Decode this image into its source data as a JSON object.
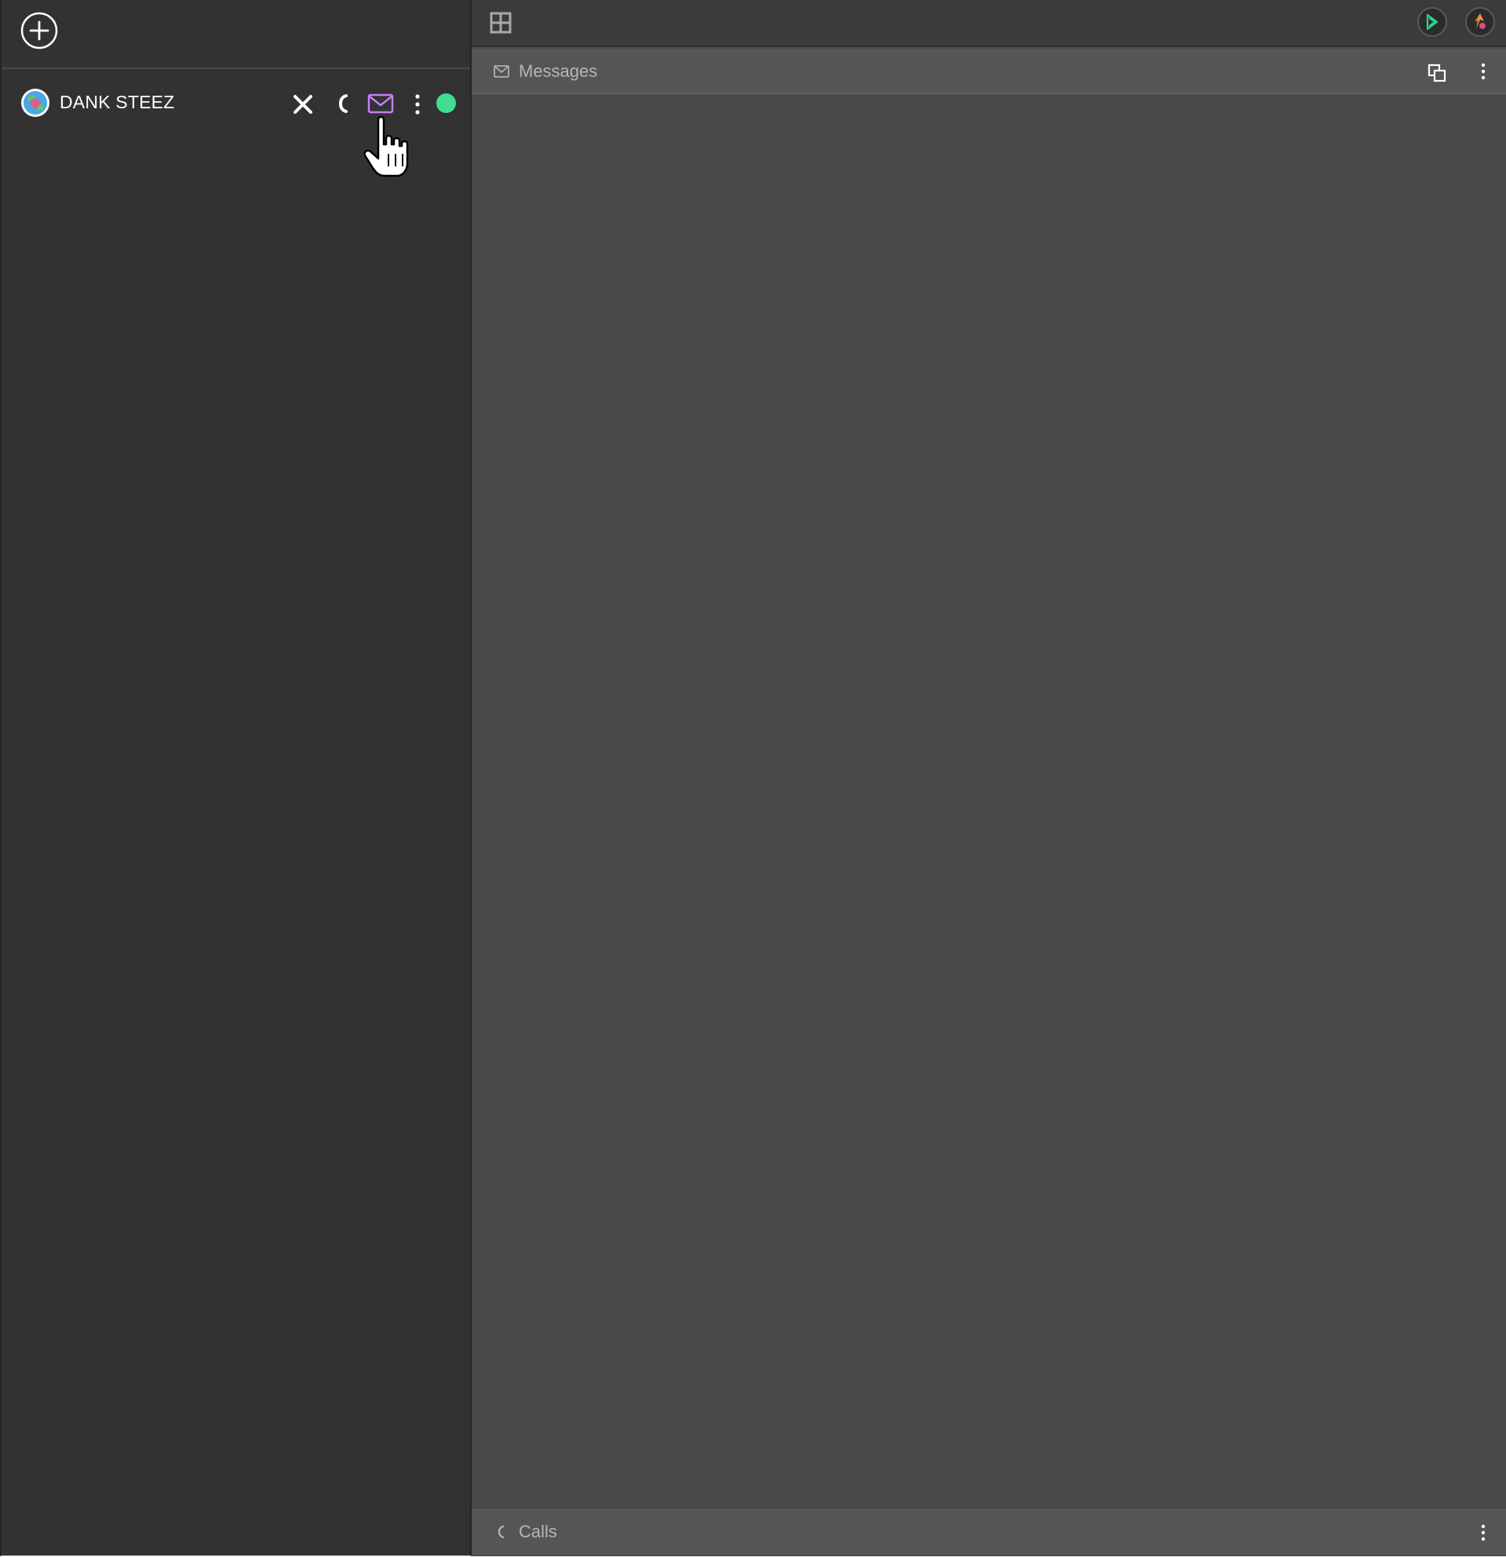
{
  "sidebar": {
    "add_button_icon": "plus-circle-icon",
    "account": {
      "name": "DANK STEEZ",
      "avatar_icon": "globe-heart-avatar-icon",
      "actions": {
        "close_icon": "close-icon",
        "call_icon": "phone-icon",
        "messages_icon": "envelope-icon",
        "more_icon": "more-vertical-icon"
      },
      "status": "online",
      "status_color": "#3ee08f",
      "messages_icon_color": "#c77dff"
    }
  },
  "topbar": {
    "layout_icon": "grid-layout-icon",
    "avatars": [
      "green-logo-avatar",
      "orange-logo-avatar"
    ]
  },
  "messages_panel": {
    "title": "Messages",
    "icon": "envelope-icon",
    "actions": [
      "popout-icon",
      "more-vertical-icon"
    ]
  },
  "calls_panel": {
    "title": "Calls",
    "icon": "phone-icon",
    "actions": [
      "more-vertical-icon"
    ]
  },
  "colors": {
    "sidebar_bg": "#323232",
    "main_bg": "#4a4a4a",
    "panel_header_bg": "#555555",
    "topbar_bg": "#3b3b3b",
    "accent_green": "#3ee08f",
    "accent_purple": "#c77dff"
  }
}
